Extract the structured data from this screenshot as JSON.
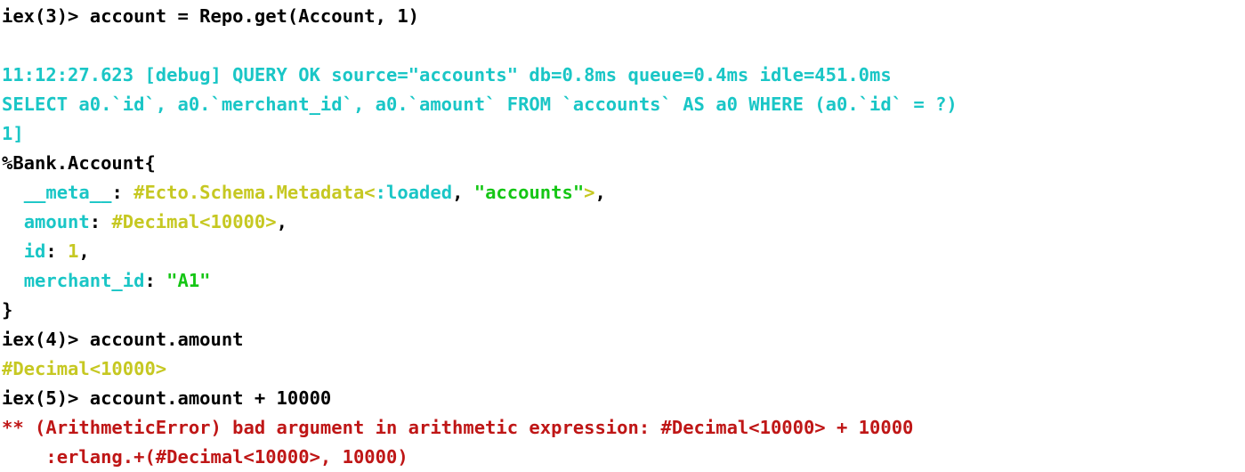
{
  "terminal": {
    "title": "iex session",
    "background_color": "#ffffff",
    "colors": {
      "default": "#000000",
      "cyan": "#1ac6c6",
      "yellow": "#c6c822",
      "green": "#15c615",
      "red": "#bf1616"
    },
    "lines": [
      {
        "id": "line-1-prompt-iex3",
        "name": "prompt-line-iex-3",
        "segments": [
          {
            "text": "iex(3)> account = Repo.get(Account, 1)",
            "color": "default"
          }
        ]
      },
      {
        "id": "line-2-blank",
        "name": "blank-line",
        "segments": [
          {
            "text": "",
            "color": "default"
          }
        ]
      },
      {
        "id": "line-3-debug-query",
        "name": "debug-query-log-line",
        "segments": [
          {
            "text": "11:12:27.623 [debug] QUERY OK source=\"accounts\" db=0.8ms queue=0.4ms idle=451.0ms",
            "color": "cyan"
          }
        ]
      },
      {
        "id": "line-4-sql",
        "name": "sql-statement-line",
        "segments": [
          {
            "text": "SELECT a0.`id`, a0.`merchant_id`, a0.`amount` FROM `accounts` AS a0 WHERE (a0.`id` = ?)",
            "color": "cyan"
          }
        ]
      },
      {
        "id": "line-5-params",
        "name": "sql-params-line",
        "segments": [
          {
            "text": "1]",
            "color": "cyan"
          }
        ]
      },
      {
        "id": "line-6-struct-open",
        "name": "struct-open-line",
        "segments": [
          {
            "text": "%Bank.Account{",
            "color": "default"
          }
        ]
      },
      {
        "id": "line-7-meta",
        "name": "struct-field-meta",
        "segments": [
          {
            "text": "  ",
            "color": "default"
          },
          {
            "text": "__meta__",
            "color": "cyan"
          },
          {
            "text": ": ",
            "color": "default"
          },
          {
            "text": "#Ecto.Schema.Metadata<",
            "color": "yellow"
          },
          {
            "text": ":loaded",
            "color": "cyan"
          },
          {
            "text": ", ",
            "color": "default"
          },
          {
            "text": "\"accounts\"",
            "color": "green"
          },
          {
            "text": ">",
            "color": "yellow"
          },
          {
            "text": ",",
            "color": "default"
          }
        ]
      },
      {
        "id": "line-8-amount",
        "name": "struct-field-amount",
        "segments": [
          {
            "text": "  ",
            "color": "default"
          },
          {
            "text": "amount",
            "color": "cyan"
          },
          {
            "text": ": ",
            "color": "default"
          },
          {
            "text": "#Decimal<10000>",
            "color": "yellow"
          },
          {
            "text": ",",
            "color": "default"
          }
        ]
      },
      {
        "id": "line-9-id",
        "name": "struct-field-id",
        "segments": [
          {
            "text": "  ",
            "color": "default"
          },
          {
            "text": "id",
            "color": "cyan"
          },
          {
            "text": ": ",
            "color": "default"
          },
          {
            "text": "1",
            "color": "yellow"
          },
          {
            "text": ",",
            "color": "default"
          }
        ]
      },
      {
        "id": "line-10-merchant-id",
        "name": "struct-field-merchant-id",
        "segments": [
          {
            "text": "  ",
            "color": "default"
          },
          {
            "text": "merchant_id",
            "color": "cyan"
          },
          {
            "text": ": ",
            "color": "default"
          },
          {
            "text": "\"A1\"",
            "color": "green"
          }
        ]
      },
      {
        "id": "line-11-struct-close",
        "name": "struct-close-line",
        "segments": [
          {
            "text": "}",
            "color": "default"
          }
        ]
      },
      {
        "id": "line-12-prompt-iex4",
        "name": "prompt-line-iex-4",
        "segments": [
          {
            "text": "iex(4)> account.amount",
            "color": "default"
          }
        ]
      },
      {
        "id": "line-13-decimal-result",
        "name": "decimal-result-line",
        "segments": [
          {
            "text": "#Decimal<10000>",
            "color": "yellow"
          }
        ]
      },
      {
        "id": "line-14-prompt-iex5",
        "name": "prompt-line-iex-5",
        "segments": [
          {
            "text": "iex(5)> account.amount + 10000",
            "color": "default"
          }
        ]
      },
      {
        "id": "line-15-error",
        "name": "arithmetic-error-line",
        "segments": [
          {
            "text": "** (ArithmeticError) bad argument in arithmetic expression: #Decimal<10000> + 10000",
            "color": "red"
          }
        ]
      },
      {
        "id": "line-16-error-trace",
        "name": "error-stacktrace-line",
        "segments": [
          {
            "text": "    :erlang.+(#Decimal<10000>, 10000)",
            "color": "red"
          }
        ]
      }
    ]
  }
}
